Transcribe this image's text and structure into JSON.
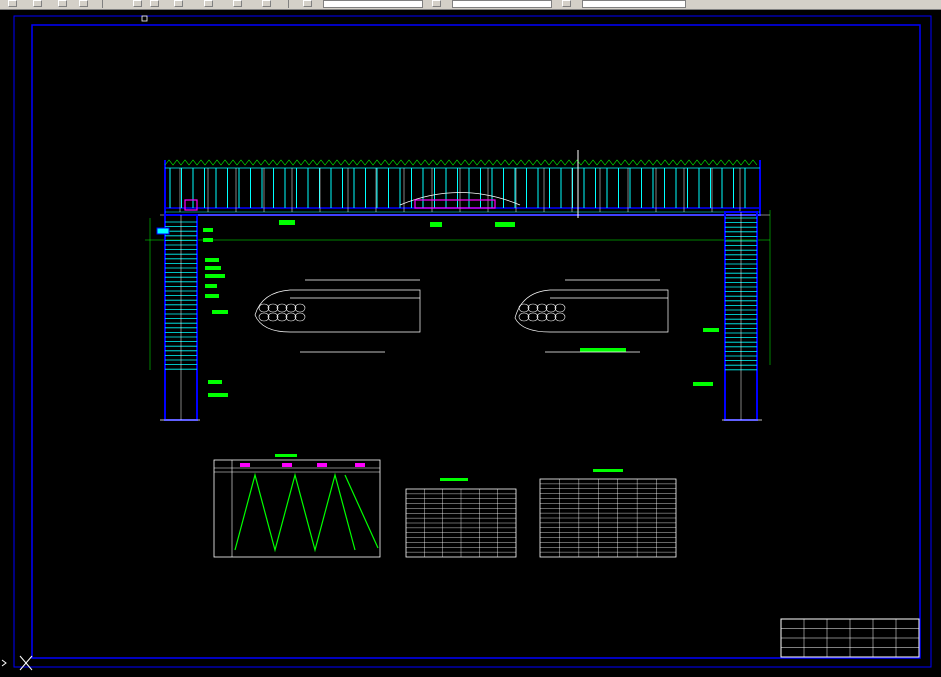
{
  "toolbar": {
    "icons": [
      "arrow-down-icon",
      "redo-icon",
      "grid-icon",
      "zoom-window-icon",
      "pan-icon",
      "rectangle-icon",
      "square-icon",
      "brush-icon",
      "pencil-icon",
      "printer-icon",
      "table-icon"
    ],
    "layer_field": "",
    "style_field": "",
    "linetype_field": ""
  },
  "drawing": {
    "background": "#000000",
    "frame_color": "#0000ff",
    "accent_colors": {
      "cyan": "#00ffff",
      "green": "#00ff00",
      "magenta": "#ff00ff",
      "white": "#ffffff"
    },
    "tables": [
      {
        "name": "diagonal-chart-table",
        "rows": 6,
        "cols": 5
      },
      {
        "name": "material-table-center",
        "rows": 14,
        "cols": 6
      },
      {
        "name": "material-table-right",
        "rows": 16,
        "cols": 7
      }
    ],
    "title_block": {
      "rows": 4,
      "cols": 6
    }
  },
  "cursor": {
    "symbol": "crosshair-ucs-icon"
  }
}
